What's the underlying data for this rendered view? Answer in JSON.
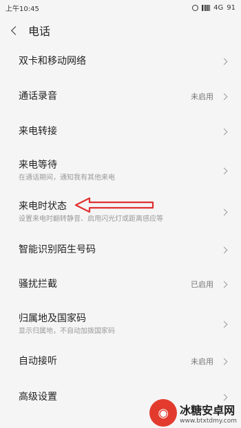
{
  "status_bar": {
    "time": "上午10:45",
    "network": "4G",
    "battery": "91"
  },
  "header": {
    "title": "电话"
  },
  "items": [
    {
      "title": "双卡和移动网络",
      "subtitle": "",
      "status": ""
    },
    {
      "title": "通话录音",
      "subtitle": "",
      "status": "未启用"
    },
    {
      "title": "来电转接",
      "subtitle": "",
      "status": ""
    },
    {
      "title": "来电等待",
      "subtitle": "在通话期间，通知我有其他来电",
      "status": ""
    },
    {
      "title": "来电时状态",
      "subtitle": "设置来电时翻转静音、启用闪光灯或距离感应等",
      "status": ""
    },
    {
      "title": "智能识别陌生号码",
      "subtitle": "",
      "status": ""
    },
    {
      "title": "骚扰拦截",
      "subtitle": "",
      "status": "已启用"
    },
    {
      "title": "归属地及国家码",
      "subtitle": "显示归属地，不自动加拨国家码",
      "status": ""
    },
    {
      "title": "自动接听",
      "subtitle": "",
      "status": "未启用"
    },
    {
      "title": "高级设置",
      "subtitle": "",
      "status": ""
    }
  ],
  "watermark": {
    "title": "冰糖安卓网",
    "url": "www.btxtdmy.com"
  },
  "colors": {
    "annotation_arrow": "#e03030",
    "watermark_logo": "#e23b2e"
  }
}
